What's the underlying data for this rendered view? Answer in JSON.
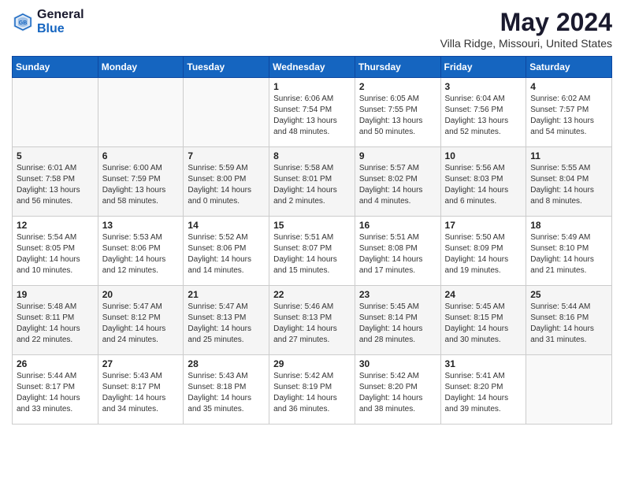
{
  "header": {
    "logo_line1": "General",
    "logo_line2": "Blue",
    "month": "May 2024",
    "location": "Villa Ridge, Missouri, United States"
  },
  "days_of_week": [
    "Sunday",
    "Monday",
    "Tuesday",
    "Wednesday",
    "Thursday",
    "Friday",
    "Saturday"
  ],
  "weeks": [
    [
      {
        "day": "",
        "content": ""
      },
      {
        "day": "",
        "content": ""
      },
      {
        "day": "",
        "content": ""
      },
      {
        "day": "1",
        "content": "Sunrise: 6:06 AM\nSunset: 7:54 PM\nDaylight: 13 hours\nand 48 minutes."
      },
      {
        "day": "2",
        "content": "Sunrise: 6:05 AM\nSunset: 7:55 PM\nDaylight: 13 hours\nand 50 minutes."
      },
      {
        "day": "3",
        "content": "Sunrise: 6:04 AM\nSunset: 7:56 PM\nDaylight: 13 hours\nand 52 minutes."
      },
      {
        "day": "4",
        "content": "Sunrise: 6:02 AM\nSunset: 7:57 PM\nDaylight: 13 hours\nand 54 minutes."
      }
    ],
    [
      {
        "day": "5",
        "content": "Sunrise: 6:01 AM\nSunset: 7:58 PM\nDaylight: 13 hours\nand 56 minutes."
      },
      {
        "day": "6",
        "content": "Sunrise: 6:00 AM\nSunset: 7:59 PM\nDaylight: 13 hours\nand 58 minutes."
      },
      {
        "day": "7",
        "content": "Sunrise: 5:59 AM\nSunset: 8:00 PM\nDaylight: 14 hours\nand 0 minutes."
      },
      {
        "day": "8",
        "content": "Sunrise: 5:58 AM\nSunset: 8:01 PM\nDaylight: 14 hours\nand 2 minutes."
      },
      {
        "day": "9",
        "content": "Sunrise: 5:57 AM\nSunset: 8:02 PM\nDaylight: 14 hours\nand 4 minutes."
      },
      {
        "day": "10",
        "content": "Sunrise: 5:56 AM\nSunset: 8:03 PM\nDaylight: 14 hours\nand 6 minutes."
      },
      {
        "day": "11",
        "content": "Sunrise: 5:55 AM\nSunset: 8:04 PM\nDaylight: 14 hours\nand 8 minutes."
      }
    ],
    [
      {
        "day": "12",
        "content": "Sunrise: 5:54 AM\nSunset: 8:05 PM\nDaylight: 14 hours\nand 10 minutes."
      },
      {
        "day": "13",
        "content": "Sunrise: 5:53 AM\nSunset: 8:06 PM\nDaylight: 14 hours\nand 12 minutes."
      },
      {
        "day": "14",
        "content": "Sunrise: 5:52 AM\nSunset: 8:06 PM\nDaylight: 14 hours\nand 14 minutes."
      },
      {
        "day": "15",
        "content": "Sunrise: 5:51 AM\nSunset: 8:07 PM\nDaylight: 14 hours\nand 15 minutes."
      },
      {
        "day": "16",
        "content": "Sunrise: 5:51 AM\nSunset: 8:08 PM\nDaylight: 14 hours\nand 17 minutes."
      },
      {
        "day": "17",
        "content": "Sunrise: 5:50 AM\nSunset: 8:09 PM\nDaylight: 14 hours\nand 19 minutes."
      },
      {
        "day": "18",
        "content": "Sunrise: 5:49 AM\nSunset: 8:10 PM\nDaylight: 14 hours\nand 21 minutes."
      }
    ],
    [
      {
        "day": "19",
        "content": "Sunrise: 5:48 AM\nSunset: 8:11 PM\nDaylight: 14 hours\nand 22 minutes."
      },
      {
        "day": "20",
        "content": "Sunrise: 5:47 AM\nSunset: 8:12 PM\nDaylight: 14 hours\nand 24 minutes."
      },
      {
        "day": "21",
        "content": "Sunrise: 5:47 AM\nSunset: 8:13 PM\nDaylight: 14 hours\nand 25 minutes."
      },
      {
        "day": "22",
        "content": "Sunrise: 5:46 AM\nSunset: 8:13 PM\nDaylight: 14 hours\nand 27 minutes."
      },
      {
        "day": "23",
        "content": "Sunrise: 5:45 AM\nSunset: 8:14 PM\nDaylight: 14 hours\nand 28 minutes."
      },
      {
        "day": "24",
        "content": "Sunrise: 5:45 AM\nSunset: 8:15 PM\nDaylight: 14 hours\nand 30 minutes."
      },
      {
        "day": "25",
        "content": "Sunrise: 5:44 AM\nSunset: 8:16 PM\nDaylight: 14 hours\nand 31 minutes."
      }
    ],
    [
      {
        "day": "26",
        "content": "Sunrise: 5:44 AM\nSunset: 8:17 PM\nDaylight: 14 hours\nand 33 minutes."
      },
      {
        "day": "27",
        "content": "Sunrise: 5:43 AM\nSunset: 8:17 PM\nDaylight: 14 hours\nand 34 minutes."
      },
      {
        "day": "28",
        "content": "Sunrise: 5:43 AM\nSunset: 8:18 PM\nDaylight: 14 hours\nand 35 minutes."
      },
      {
        "day": "29",
        "content": "Sunrise: 5:42 AM\nSunset: 8:19 PM\nDaylight: 14 hours\nand 36 minutes."
      },
      {
        "day": "30",
        "content": "Sunrise: 5:42 AM\nSunset: 8:20 PM\nDaylight: 14 hours\nand 38 minutes."
      },
      {
        "day": "31",
        "content": "Sunrise: 5:41 AM\nSunset: 8:20 PM\nDaylight: 14 hours\nand 39 minutes."
      },
      {
        "day": "",
        "content": ""
      }
    ]
  ]
}
